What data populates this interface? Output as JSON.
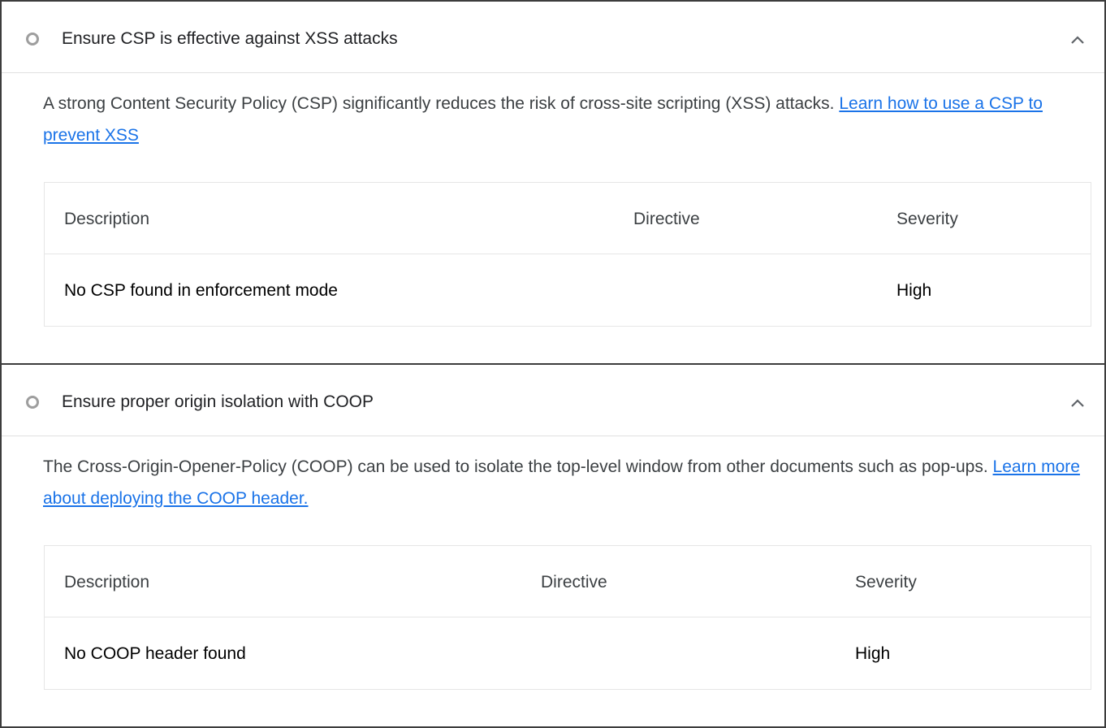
{
  "audits": [
    {
      "title": "Ensure CSP is effective against XSS attacks",
      "description_text": "A strong Content Security Policy (CSP) significantly reduces the risk of cross-site scripting (XSS) attacks. ",
      "link_text": "Learn how to use a CSP to prevent XSS",
      "status_icon": "circle-outline-icon",
      "expand_icon": "chevron-up-icon",
      "table": {
        "headers": [
          "Description",
          "Directive",
          "Severity"
        ],
        "rows": [
          [
            "No CSP found in enforcement mode",
            "",
            "High"
          ]
        ]
      }
    },
    {
      "title": "Ensure proper origin isolation with COOP",
      "description_text": "The Cross-Origin-Opener-Policy (COOP) can be used to isolate the top-level window from other documents such as pop-ups. ",
      "link_text": "Learn more about deploying the COOP header.",
      "status_icon": "circle-outline-icon",
      "expand_icon": "chevron-up-icon",
      "table": {
        "headers": [
          "Description",
          "Directive",
          "Severity"
        ],
        "rows": [
          [
            "No COOP header found",
            "",
            "High"
          ]
        ]
      }
    }
  ],
  "colors": {
    "link": "#1a73e8",
    "status_icon": "#9e9e9e",
    "border": "#3c3c3c"
  }
}
